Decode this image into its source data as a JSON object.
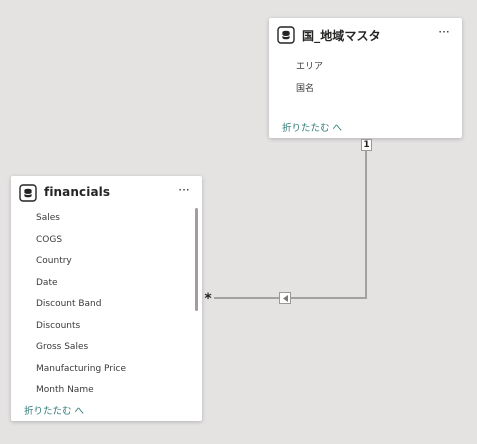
{
  "tables": {
    "region": {
      "title": "国_地域マスタ",
      "more": "···",
      "fields": [
        "エリア",
        "国名"
      ],
      "collapse": "折りたたむ へ"
    },
    "financials": {
      "title": "financials",
      "more": "···",
      "fields": [
        "Sales",
        "COGS",
        "Country",
        "Date",
        "Discount Band",
        "Discounts",
        "Gross Sales",
        "Manufacturing Price",
        "Month Name"
      ],
      "collapse": "折りたたむ へ"
    }
  },
  "relationship": {
    "one_side_label": "1",
    "many_side_label": "*",
    "cross_filter_direction": "single"
  },
  "colors": {
    "canvas": "#e4e3e2",
    "card": "#ffffff",
    "link": "#2f7a76",
    "connector": "#a3a2a0"
  }
}
